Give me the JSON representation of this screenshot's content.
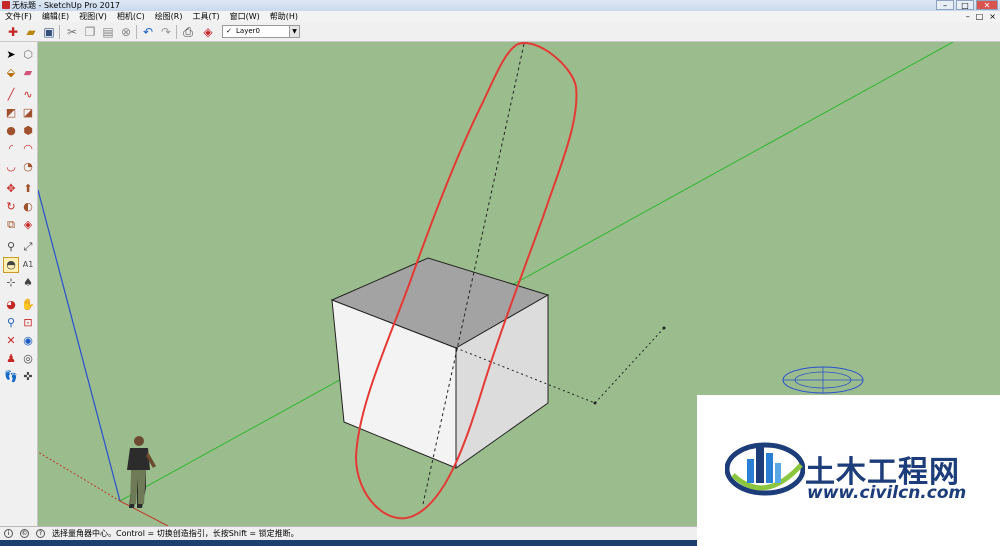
{
  "window": {
    "title": "无标题 - SketchUp Pro 2017",
    "controls": [
      "–",
      "□",
      "✕"
    ]
  },
  "menu": {
    "items": [
      "文件(F)",
      "编辑(E)",
      "视图(V)",
      "相机(C)",
      "绘图(R)",
      "工具(T)",
      "窗口(W)",
      "帮助(H)"
    ],
    "doc_controls": [
      "–",
      "□",
      "×"
    ]
  },
  "toolbar": {
    "icons": [
      "new-model-icon",
      "open-icon",
      "save-icon",
      "cut-icon",
      "copy-icon",
      "paste-icon",
      "erase-icon",
      "undo-icon",
      "redo-icon",
      "print-icon",
      "model-info-icon"
    ],
    "layer": {
      "check": "✓",
      "value": "Layer0"
    }
  },
  "left_tools": [
    [
      "select-icon",
      "component-icon"
    ],
    [
      "paint-bucket-icon",
      "eraser-icon"
    ],
    [
      "line-icon",
      "freehand-icon"
    ],
    [
      "rectangle-icon",
      "rotated-rectangle-icon"
    ],
    [
      "circle-icon",
      "polygon-icon"
    ],
    [
      "arc-icon",
      "two-point-arc-icon"
    ],
    [
      "three-point-arc-icon",
      "pie-icon"
    ],
    [
      "move-icon",
      "push-pull-icon"
    ],
    [
      "rotate-icon",
      "follow-me-icon"
    ],
    [
      "scale-icon",
      "offset-icon"
    ],
    [
      "tape-measure-icon",
      "dimension-icon"
    ],
    [
      "protractor-icon",
      "text-icon"
    ],
    [
      "axes-icon",
      "3d-text-icon"
    ],
    [
      "orbit-icon",
      "pan-icon"
    ],
    [
      "zoom-icon",
      "zoom-window-icon"
    ],
    [
      "zoom-extents-icon",
      "previous-view-icon"
    ],
    [
      "position-camera-icon",
      "look-around-icon"
    ],
    [
      "walk-icon",
      "section-plane-icon"
    ]
  ],
  "status": {
    "text": "选择量角器中心。Control = 切换创造指引，长按Shift = 锁定推断。"
  },
  "watermark": {
    "brand": "土木工程网",
    "url": "www.civilcn.com"
  },
  "colors": {
    "viewport_bg": "#9bbd8d",
    "annotation_red": "#e53935",
    "green_axis": "#2fb52f",
    "blue_axis": "#2b4ed0",
    "red_axis": "#c0392b",
    "brand_blue": "#1d3d7a"
  }
}
